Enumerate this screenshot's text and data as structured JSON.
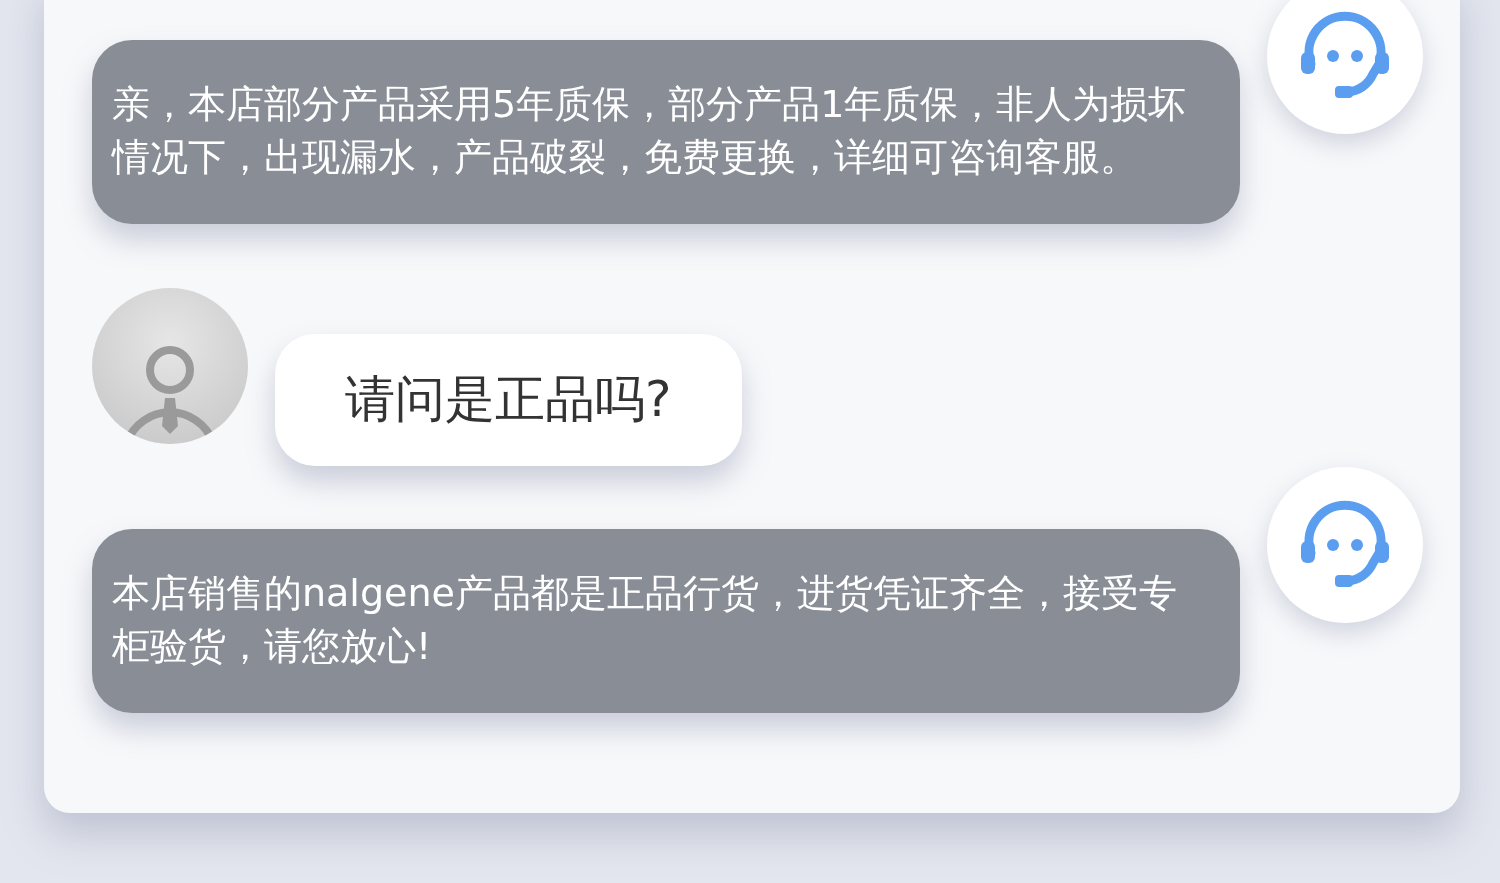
{
  "messages": [
    {
      "kind": "agent",
      "text": "亲，本店部分产品采用5年质保，部分产品1年质保，非人为损坏情况下，出现漏水，产品破裂，免费更换，详细可咨询客服。"
    },
    {
      "kind": "user",
      "text": "请问是正品吗?"
    },
    {
      "kind": "agent",
      "text": "本店销售的nalgene产品都是正品行货，进货凭证齐全，接受专柜验货，请您放心!"
    }
  ]
}
